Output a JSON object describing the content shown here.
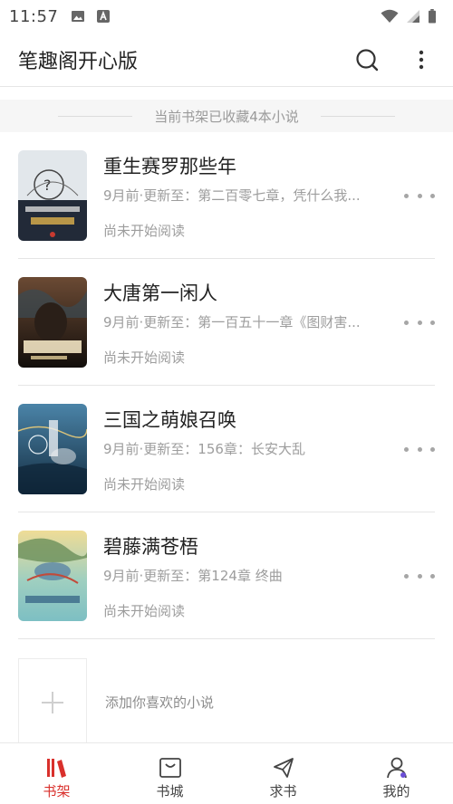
{
  "status_bar": {
    "time": "11:57"
  },
  "app_bar": {
    "title": "笔趣阁开心版"
  },
  "shelf": {
    "count_text": "当前书架已收藏4本小说"
  },
  "books": [
    {
      "title": "重生赛罗那些年",
      "update": "9月前·更新至：第二百零七章，凭什么我...",
      "progress": "尚未开始阅读",
      "cover_colors": [
        "#dfe5ea",
        "#1c2433"
      ]
    },
    {
      "title": "大唐第一闲人",
      "update": "9月前·更新至：第一百五十一章《图财害...",
      "progress": "尚未开始阅读",
      "cover_colors": [
        "#5a3a28",
        "#1a140f"
      ]
    },
    {
      "title": "三国之萌娘召唤",
      "update": "9月前·更新至：156章：长安大乱",
      "progress": "尚未开始阅读",
      "cover_colors": [
        "#3d6f93",
        "#17344d"
      ]
    },
    {
      "title": "碧藤满苍梧",
      "update": "9月前·更新至：第124章 终曲",
      "progress": "尚未开始阅读",
      "cover_colors": [
        "#e8d48d",
        "#7fc3c4"
      ]
    }
  ],
  "add_novel": {
    "label": "添加你喜欢的小说"
  },
  "bottom_nav": {
    "items": [
      {
        "label": "书架",
        "active": true
      },
      {
        "label": "书城",
        "active": false
      },
      {
        "label": "求书",
        "active": false
      },
      {
        "label": "我的",
        "active": false
      }
    ]
  },
  "colors": {
    "accent": "#d9302c",
    "muted_text": "#9d9d9d",
    "divider": "#e5e5e5"
  }
}
